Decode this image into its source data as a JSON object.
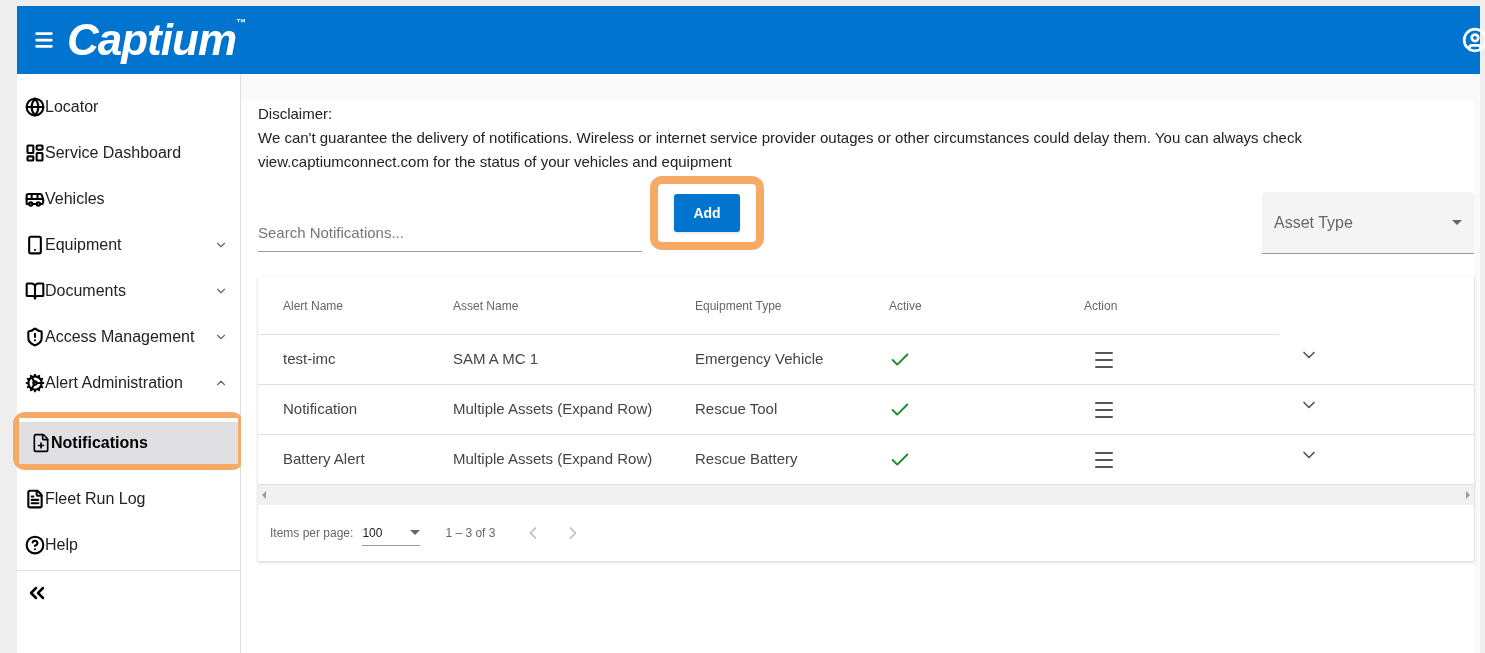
{
  "header": {
    "logo": "Captium",
    "logo_mark": "™"
  },
  "sidebar": {
    "items": [
      {
        "label": "Locator",
        "kind": "link"
      },
      {
        "label": "Service Dashboard",
        "kind": "link"
      },
      {
        "label": "Vehicles",
        "kind": "link"
      },
      {
        "label": "Equipment",
        "kind": "group",
        "expanded": false
      },
      {
        "label": "Documents",
        "kind": "group",
        "expanded": false
      },
      {
        "label": "Access Management",
        "kind": "group",
        "expanded": false
      },
      {
        "label": "Alert Administration",
        "kind": "group",
        "expanded": true,
        "children": [
          {
            "label": "Notifications",
            "selected": true,
            "highlighted": true
          }
        ]
      },
      {
        "label": "Fleet Run Log",
        "kind": "link"
      },
      {
        "label": "Help",
        "kind": "link"
      }
    ]
  },
  "disclaimer": {
    "title": "Disclaimer:",
    "text": "We can't guarantee the delivery of notifications. Wireless or internet service provider outages or other circumstances could delay them. You can always check view.captiumconnect.com for the status of your vehicles and equipment"
  },
  "search": {
    "placeholder": "Search Notifications..."
  },
  "add_button": {
    "label": "Add",
    "highlighted": true
  },
  "asset_type": {
    "placeholder": "Asset Type"
  },
  "table": {
    "columns": [
      "Alert Name",
      "Asset Name",
      "Equipment Type",
      "Active",
      "Action"
    ],
    "rows": [
      {
        "alert_name": "test-imc",
        "asset_name": "SAM A MC 1",
        "equipment_type": "Emergency Vehicle",
        "active": true,
        "expanded": false
      },
      {
        "alert_name": "Notification",
        "asset_name": "Multiple Assets (Expand Row)",
        "equipment_type": "Rescue Tool",
        "active": true,
        "expanded": false
      },
      {
        "alert_name": "Battery Alert",
        "asset_name": "Multiple Assets (Expand Row)",
        "equipment_type": "Rescue Battery",
        "active": true,
        "expanded": false
      }
    ]
  },
  "paginator": {
    "label": "Items per page:",
    "page_size": "100",
    "range": "1 – 3 of 3"
  }
}
